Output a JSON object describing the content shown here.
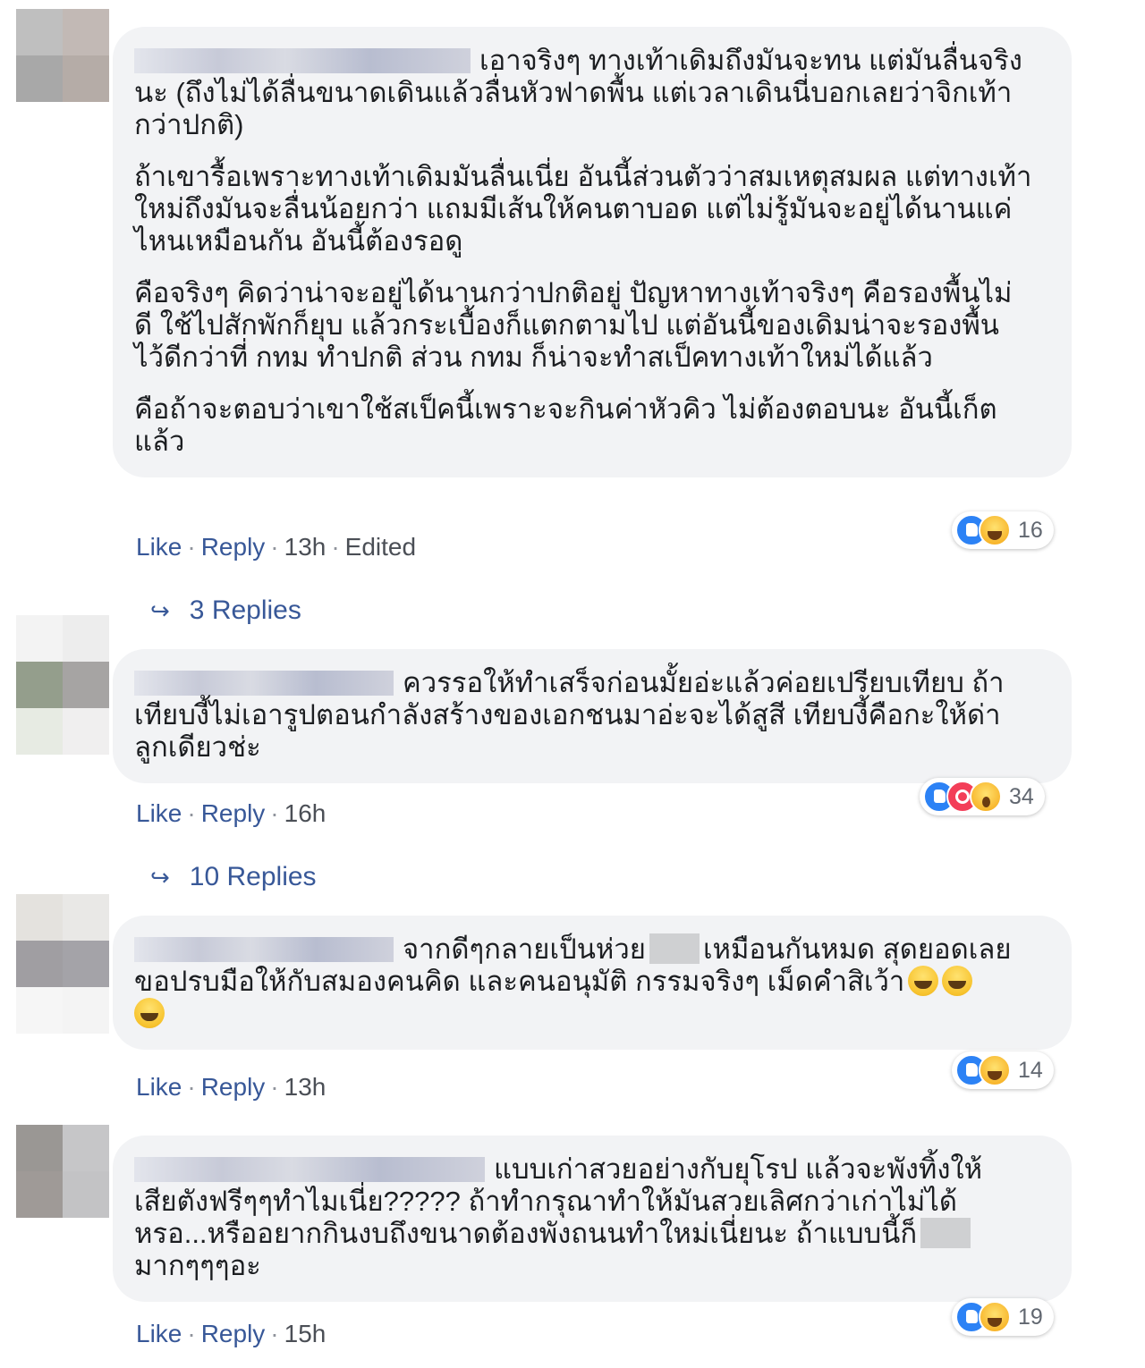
{
  "comments": [
    {
      "paragraphs": [
        "เอาจริงๆ ทางเท้าเดิมถึงมันจะทน แต่มันลื่นจริง\nนะ (ถึงไม่ได้ลื่นขนาดเดินแล้วลื่นหัวฟาดพื้น แต่เวลาเดินนี่บอกเลยว่าจิกเท้า\nกว่าปกติ)",
        "ถ้าเขารื้อเพราะทางเท้าเดิมมันลื่นเนี่ย อันนี้ส่วนตัวว่าสมเหตุสมผล แต่ทางเท้า\nใหม่ถึงมันจะลื่นน้อยกว่า แถมมีเส้นให้คนตาบอด แต่ไม่รู้มันจะอยู่ได้นานแค่\nไหนเหมือนกัน อันนี้ต้องรอดู",
        "คือจริงๆ คิดว่าน่าจะอยู่ได้นานกว่าปกติอยู่ ปัญหาทางเท้าจริงๆ คือรองพื้นไม่\nดี ใช้ไปสักพักก็ยุบ แล้วกระเบื้องก็แตกตามไป แต่อันนี้ของเดิมน่าจะรองพื้น\nไว้ดีกว่าที่ กทม ทำปกติ ส่วน กทม ก็น่าจะทำสเป็คทางเท้าใหม่ได้แล้ว",
        "คือถ้าจะตอบว่าเขาใช้สเป็คนี้เพราะจะกินค่าหัวคิว ไม่ต้องตอบนะ อันนี้เก็ต\nแล้ว"
      ],
      "like": "Like",
      "reply": "Reply",
      "time": "13h",
      "edited": "Edited",
      "reaction_count": "16",
      "replies_label": "3 Replies"
    },
    {
      "paragraphs": [
        "ควรรอให้ทำเสร็จก่อนมั้ยอ่ะแล้วค่อยเปรียบเทียบ ถ้า\nเทียบงี้ไม่เอารูปตอนกำลังสร้างของเอกชนมาอ่ะจะได้สูสี เทียบงี้คือกะให้ด่า\nลูกเดียวช่ะ"
      ],
      "like": "Like",
      "reply": "Reply",
      "time": "16h",
      "reaction_count": "34",
      "replies_label": "10 Replies"
    },
    {
      "text_a": "จากดีๆกลายเป็นห่วย",
      "text_b": "เหมือนกันหมด สุดยอดเลย",
      "text_c": "ขอปรบมือให้กับสมองคนคิด และคนอนุมัติ กรรมจริงๆ เม็ดคำสิเว้า",
      "like": "Like",
      "reply": "Reply",
      "time": "13h",
      "reaction_count": "14"
    },
    {
      "text_a": "แบบเก่าสวยอย่างกับยุโรป แล้วจะพังทิ้งให้\nเสียตังฟรีๆๆทำไมเนี่ย????? ถ้าทำกรุณาทำให้มันสวยเลิศกว่าเก่าไม่ได้\nหรอ...หรืออยากกินงบถึงขนาดต้องพังถนนทำใหม่เนี่ยนะ ถ้าแบบนี้ก็",
      "text_b": "มากๆๆๆอะ",
      "like": "Like",
      "reply": "Reply",
      "time": "15h",
      "reaction_count": "19"
    }
  ],
  "separator": "·",
  "reply_arrow": "↪",
  "icons": [
    "like-reaction-icon",
    "haha-reaction-icon",
    "love-reaction-icon",
    "wow-reaction-icon",
    "grinning-sweat-emoji"
  ],
  "colors": {
    "link": "#385898",
    "bubble": "#f2f3f5",
    "like_blue": "#2c82f5",
    "love_red": "#f33e58"
  }
}
